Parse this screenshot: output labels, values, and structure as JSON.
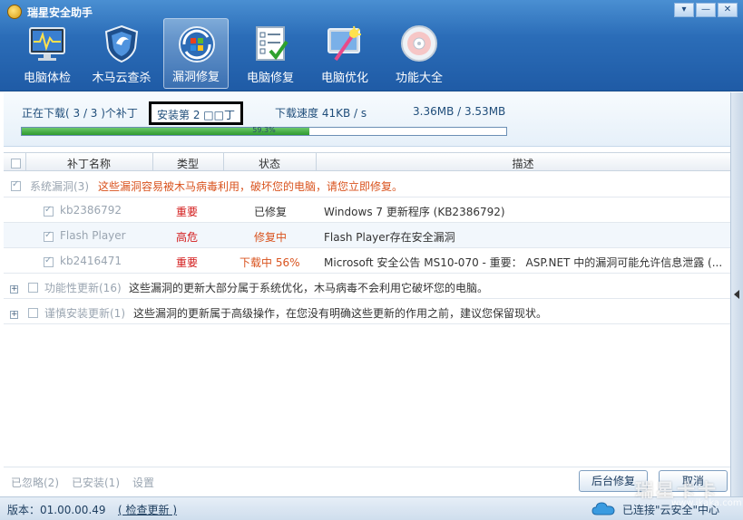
{
  "app": {
    "title": "瑞星安全助手"
  },
  "tabs": [
    {
      "label": "电脑体检",
      "icon": "monitor-pulse-icon"
    },
    {
      "label": "木马云查杀",
      "icon": "shield-icon"
    },
    {
      "label": "漏洞修复",
      "icon": "windows-repair-icon",
      "active": true
    },
    {
      "label": "电脑修复",
      "icon": "checklist-icon"
    },
    {
      "label": "电脑优化",
      "icon": "optimize-icon"
    },
    {
      "label": "功能大全",
      "icon": "disc-icon"
    }
  ],
  "download": {
    "status": "正在下载( 3 / 3 )个补丁",
    "installing": "安装第 2 □□丁",
    "speed": "下载速度 41KB / s",
    "size": "3.36MB / 3.53MB",
    "progress_text": "59.3%",
    "progress_value": 0.593
  },
  "table": {
    "headers": {
      "name": "补丁名称",
      "type": "类型",
      "status": "状态",
      "desc": "描述"
    },
    "group_system": {
      "title": "系统漏洞(3)",
      "note": "这些漏洞容易被木马病毒利用，破坏您的电脑，请您立即修复。"
    },
    "rows": [
      {
        "name": "kb2386792",
        "type": "重要",
        "status": "已修复",
        "desc": "Windows 7 更新程序 (KB2386792)"
      },
      {
        "name": "Flash Player",
        "type": "高危",
        "status": "修复中",
        "desc": "Flash Player存在安全漏洞"
      },
      {
        "name": "kb2416471",
        "type": "重要",
        "status": "下载中  56%",
        "desc": "Microsoft 安全公告 MS10-070 - 重要： ASP.NET 中的漏洞可能允许信息泄露 (..."
      }
    ],
    "group_function": {
      "title": "功能性更新(16)",
      "note": "这些漏洞的更新大部分属于系统优化，木马病毒不会利用它破坏您的电脑。"
    },
    "group_careful": {
      "title": "谨慎安装更新(1)",
      "note": "这些漏洞的更新属于高级操作，在您没有明确这些更新的作用之前，建议您保留现状。"
    }
  },
  "bottom": {
    "ignored": "已忽略(2)",
    "installed": "已安装(1)",
    "settings": "设置",
    "background_fix": "后台修复",
    "cancel": "取消"
  },
  "statusbar": {
    "version": "版本：01.00.00.49",
    "check_update": "检查更新",
    "cloud_status": "已连接\"云安全\"中心"
  },
  "watermark": {
    "main": "瑞星卡卡",
    "sub": "www.ikaka.com"
  }
}
